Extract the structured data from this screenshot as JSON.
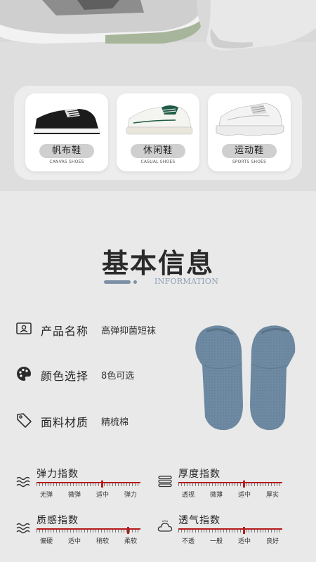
{
  "shoes": [
    {
      "name": "帆布鞋",
      "en": "CANVAS SHOES"
    },
    {
      "name": "休闲鞋",
      "en": "CASUAL SHOES"
    },
    {
      "name": "运动鞋",
      "en": "SPORTS SHOES"
    }
  ],
  "section": {
    "title": "基本信息",
    "subtitle": "INFORMATION"
  },
  "info": [
    {
      "label": "产品名称",
      "value": "高弹抑菌短袜",
      "icon": "id-card-icon"
    },
    {
      "label": "颜色选择",
      "value": "8色可选",
      "icon": "palette-icon"
    },
    {
      "label": "面料材质",
      "value": "精梳棉",
      "icon": "tag-icon"
    }
  ],
  "indices": [
    {
      "title": "弹力指数",
      "options": [
        "无弹",
        "微弹",
        "适中",
        "弹力"
      ],
      "selected_index": 2,
      "icon": "wave-icon"
    },
    {
      "title": "厚度指数",
      "options": [
        "透视",
        "微薄",
        "适中",
        "厚实"
      ],
      "selected_index": 2,
      "icon": "layers-icon"
    },
    {
      "title": "质感指数",
      "options": [
        "偏硬",
        "适中",
        "稍软",
        "柔软"
      ],
      "selected_index": 3,
      "icon": "wave-icon"
    },
    {
      "title": "透气指数",
      "options": [
        "不透",
        "一般",
        "适中",
        "良好"
      ],
      "selected_index": 2,
      "icon": "cloud-icon"
    }
  ],
  "colors": {
    "accent": "#b71c1c",
    "sock": "#6e8aa2",
    "title_bar": "#7b8fa5"
  }
}
